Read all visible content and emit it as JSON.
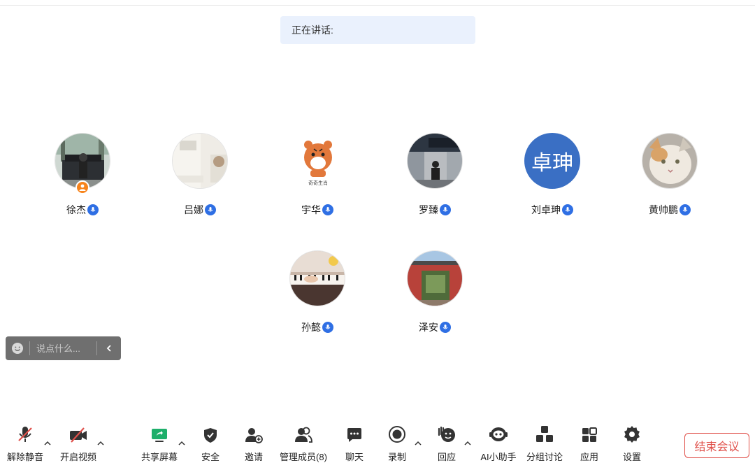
{
  "speaking": {
    "label": "正在讲话:"
  },
  "participants": [
    {
      "name": "徐杰",
      "avatar_icon": "piano-room-photo"
    },
    {
      "name": "吕娜",
      "avatar_icon": "room-photo"
    },
    {
      "name": "宇华",
      "avatar_icon": "tiger-sticker",
      "avatar_caption": "奇奇生肖"
    },
    {
      "name": "罗臻",
      "avatar_icon": "station-photo"
    },
    {
      "name": "刘卓珅",
      "avatar_text": "卓珅"
    },
    {
      "name": "黄帅鹏",
      "avatar_icon": "cat-photo"
    },
    {
      "name": "孙懿",
      "avatar_icon": "piano-keys-photo"
    },
    {
      "name": "泽安",
      "avatar_icon": "red-gate-photo"
    }
  ],
  "chat": {
    "placeholder": "说点什么..."
  },
  "toolbar": {
    "unmute": "解除静音",
    "start_video": "开启视频",
    "share_screen": "共享屏幕",
    "security": "安全",
    "invite": "邀请",
    "manage_members": "管理成员(8)",
    "chat": "聊天",
    "record": "录制",
    "reaction": "回应",
    "ai_assistant": "AI小助手",
    "breakout": "分组讨论",
    "apps": "应用",
    "settings": "设置",
    "end_meeting": "结束会议"
  },
  "colors": {
    "accent": "#2f6fe4",
    "host": "#f7841c",
    "danger": "#e0504a",
    "share_green": "#1eaf6b",
    "avatar_blue": "#3a6fc4"
  }
}
